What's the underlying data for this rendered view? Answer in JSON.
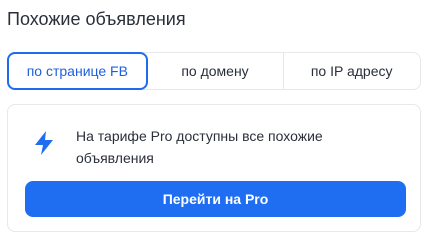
{
  "section": {
    "title": "Похожие объявления"
  },
  "tabs": [
    {
      "label": "по странице FB",
      "active": true
    },
    {
      "label": "по домену",
      "active": false
    },
    {
      "label": "по IP адресу",
      "active": false
    }
  ],
  "upsell": {
    "icon": "lightning-icon",
    "text": "На тарифе Pro доступны все похожие объявления",
    "button_label": "Перейти на Pro"
  },
  "colors": {
    "accent": "#1f6ef2",
    "text": "#2a2f3a",
    "border": "#e6e8ec"
  }
}
